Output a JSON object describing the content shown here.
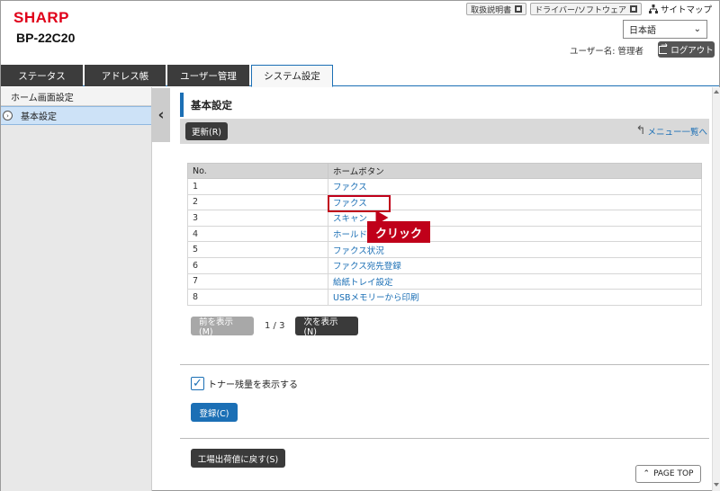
{
  "header": {
    "logo_text": "SHARP",
    "model": "BP-22C20",
    "top_links": [
      {
        "label": "取扱説明書"
      },
      {
        "label": "ドライバー/ソフトウェア"
      }
    ],
    "sitemap_label": "サイトマップ",
    "language_selected": "日本語",
    "user_label": "ユーザー名: 管理者",
    "logout_label": "ログアウト"
  },
  "tabs": [
    {
      "label": "ステータス",
      "active": false
    },
    {
      "label": "アドレス帳",
      "active": false
    },
    {
      "label": "ユーザー管理",
      "active": false
    },
    {
      "label": "システム設定",
      "active": true
    }
  ],
  "sidebar": {
    "heading": "ホーム画面設定",
    "items": [
      {
        "label": "基本設定",
        "selected": true
      }
    ]
  },
  "main": {
    "title": "基本設定",
    "refresh_label": "更新(R)",
    "menu_link": "メニュー一覧へ",
    "table": {
      "headers": [
        "No.",
        "ホームボタン"
      ],
      "rows": [
        {
          "no": "1",
          "button": "ファクス"
        },
        {
          "no": "2",
          "button": "ファクス"
        },
        {
          "no": "3",
          "button": "スキャン"
        },
        {
          "no": "4",
          "button": "ホールド"
        },
        {
          "no": "5",
          "button": "ファクス状況"
        },
        {
          "no": "6",
          "button": "ファクス宛先登録"
        },
        {
          "no": "7",
          "button": "給紙トレイ設定"
        },
        {
          "no": "8",
          "button": "USBメモリーから印刷"
        }
      ]
    },
    "callout_label": "クリック",
    "pager": {
      "prev_label": "前を表示(M)",
      "indicator": "1 / 3",
      "next_label": "次を表示(N)"
    },
    "toner_checkbox_label": "トナー残量を表示する",
    "toner_checked": true,
    "register_label": "登録(C)",
    "factory_reset_label": "工場出荷値に戻す(S)",
    "page_top_label": "PAGE TOP"
  },
  "colors": {
    "brand_red": "#e0001a",
    "accent_blue": "#1b6fb5",
    "callout_red": "#c0001a"
  }
}
